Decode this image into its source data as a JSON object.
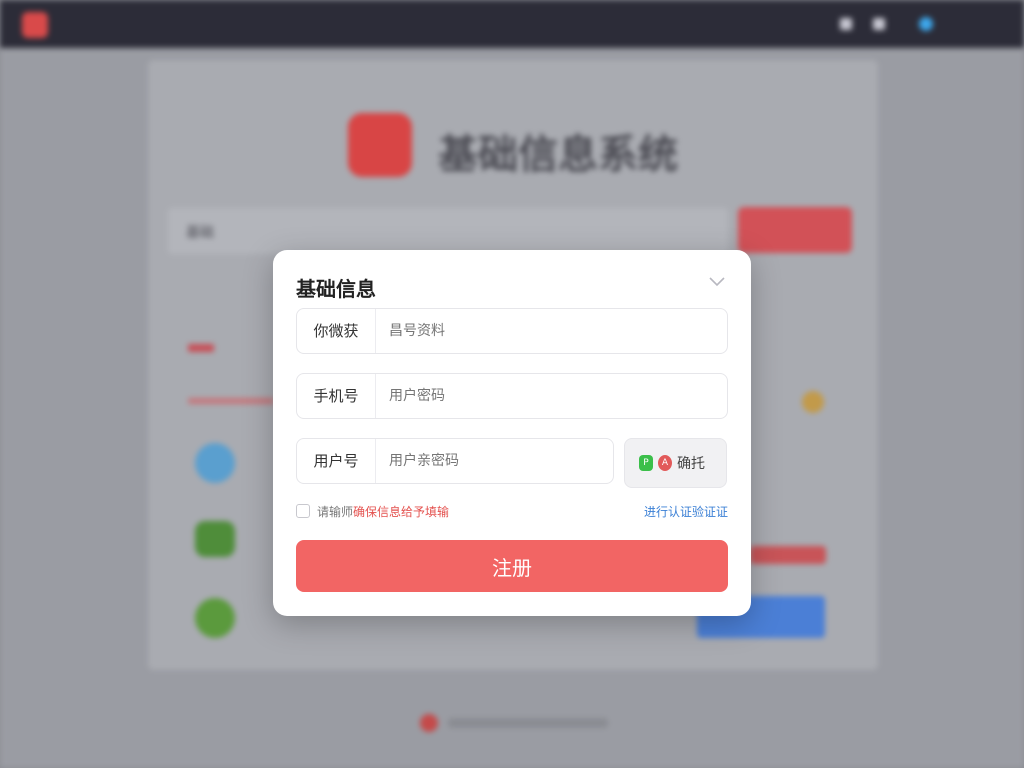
{
  "colors": {
    "accent": "#f26564",
    "link_blue": "#3a7fd5",
    "topbar_bg": "#2c2c38"
  },
  "background": {
    "brand_name": "",
    "search_placeholder": "",
    "hero_title": "基础信息系统",
    "tab_label": "基础",
    "sub_label": "",
    "icons": [
      "shield-logo-icon",
      "bell-icon",
      "mail-icon",
      "avatar-icon"
    ]
  },
  "modal": {
    "title": "基础信息",
    "collapse_icon": "chevron-down-icon",
    "fields": [
      {
        "label": "你微获",
        "placeholder": "昌号资料"
      },
      {
        "label": "手机号",
        "placeholder": "用户密码"
      },
      {
        "label": "用户号",
        "placeholder": "用户亲密码"
      }
    ],
    "captcha": {
      "badge_1": "P",
      "badge_2": "A",
      "text": "确托"
    },
    "agree": {
      "prefix": "请输师",
      "link": "确保信息给予填输",
      "checked": false
    },
    "verify_link": "进行认证验证证",
    "submit_label": "注册"
  }
}
